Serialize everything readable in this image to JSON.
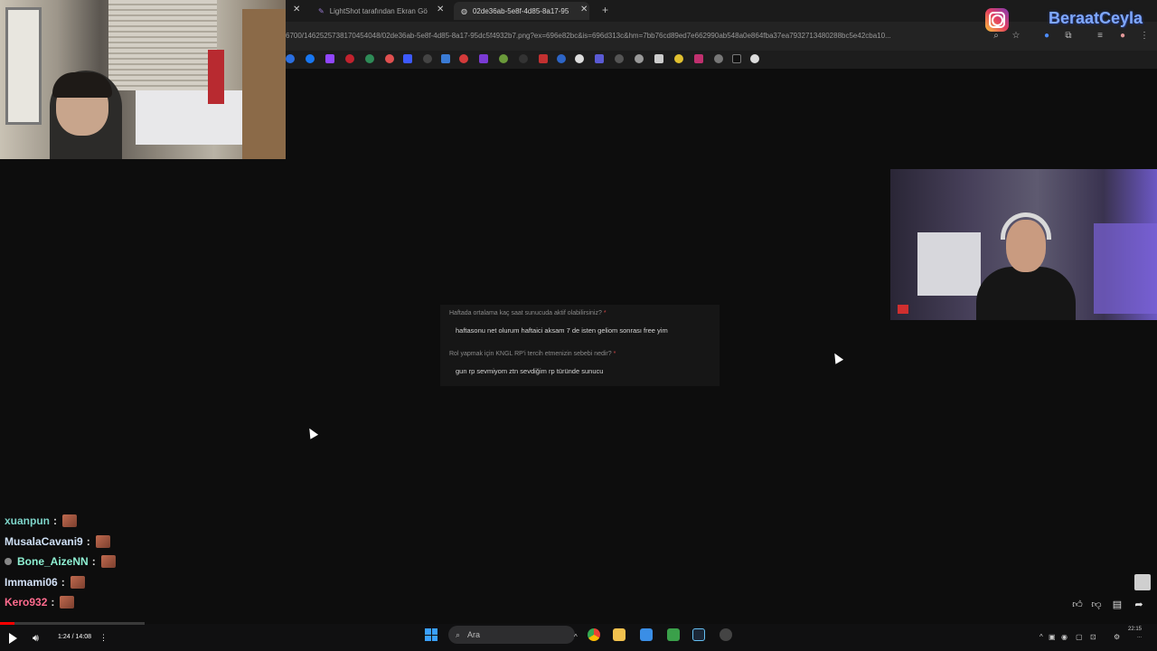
{
  "browser": {
    "tabs": [
      {
        "label": "LightShot tarafından Ekran Gö",
        "active": false
      },
      {
        "label": "02de36ab-5e8f-4d85-8a17-95",
        "active": true
      }
    ],
    "new_tab_label": "+",
    "url": "6700/1462525738170454048/02de36ab-5e8f-4d85-8a17-95dc5f4932b7.png?ex=696e82bc&is=696d313c&hm=7bb76cd89ed7e662990ab548a0e864fba37ea7932713480288bc5e42cba10..."
  },
  "overlay": {
    "instagram_handle": "BeraatCeyla"
  },
  "form": {
    "q1": "Haftada ortalama kaç saat sunucuda aktif olabilirsiniz?",
    "a1": "haftasonu net olurum haftaici aksam 7 de isten geliom sonrası free yim",
    "q2": "Rol yapmak için KNGL RP'i tercih etmenizin sebebi nedir?",
    "a2": "gun rp sevmiyom ztn sevdiğim rp türünde sunucu",
    "required_mark": "*"
  },
  "chat": [
    {
      "user": "xuanpun",
      "color": "#7dd3c8",
      "badge": false
    },
    {
      "user": "MusalaCavani9",
      "color": "#cfe0f5",
      "badge": false
    },
    {
      "user": "Bone_AizeNN",
      "color": "#8ef0d2",
      "badge": true
    },
    {
      "user": "Immami06",
      "color": "#d4e2f7",
      "badge": false
    },
    {
      "user": "Kero932",
      "color": "#ff6b8e",
      "badge": false
    }
  ],
  "chat_separator": ":",
  "player": {
    "time": "1:24 / 14:08",
    "progress": 0.099
  },
  "taskbar": {
    "search_placeholder": "Ara",
    "clock_time": "22:15",
    "clock_date": "..."
  },
  "colors": {
    "accent_red": "#ff0000",
    "handle_blue": "#7fa8ff",
    "windows_blue": "#3aa0ff"
  }
}
